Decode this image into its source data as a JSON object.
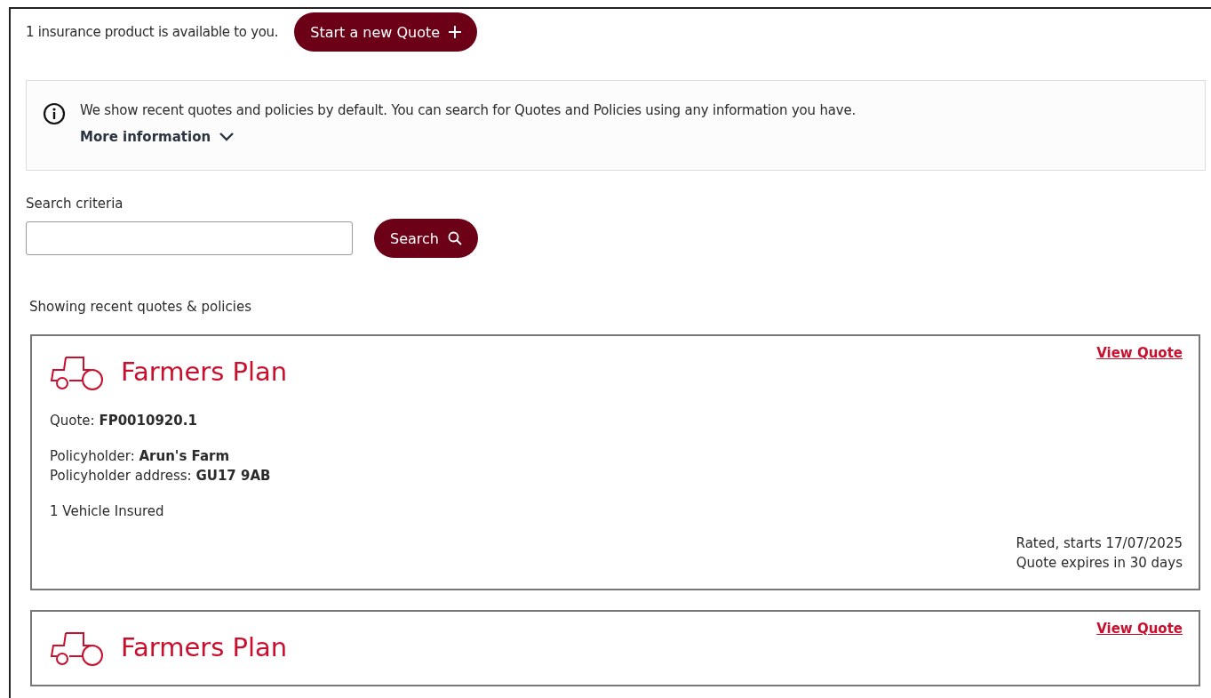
{
  "header": {
    "availability": "1 insurance product is available to you.",
    "new_quote_button": "Start a new Quote"
  },
  "info": {
    "text": "We show recent quotes and policies by default. You can search for Quotes and Policies using any information you have.",
    "more_link": "More information",
    "expanded": false
  },
  "search": {
    "label": "Search criteria",
    "button": "Search"
  },
  "results_heading": "Showing recent quotes & policies",
  "cards": [
    {
      "title": "Farmers Plan",
      "link": "View Quote",
      "quote": "Quote: **FP0010920.1**",
      "holder": "Policyholder: **Arun's Farm**",
      "address": "Policyholder address: **GU17 9AB**",
      "vehicles": "1 Vehicle Insured",
      "status": "Rated, starts 17/07/2025",
      "expiry": "Quote expires in 30 days"
    },
    {
      "title": "Farmers Plan",
      "link": "View Quote"
    }
  ]
}
